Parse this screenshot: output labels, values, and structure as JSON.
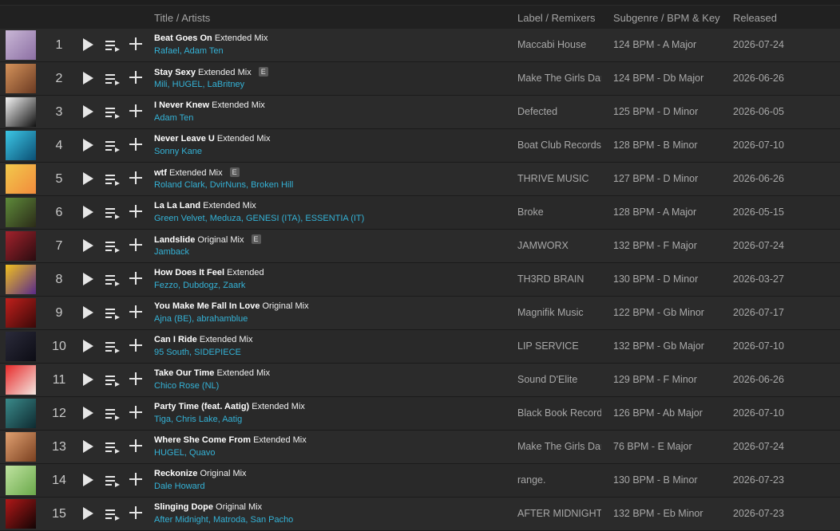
{
  "header": {
    "title_col": "Title / Artists",
    "label_col": "Label / Remixers",
    "subgenre_col": "Subgenre / BPM & Key",
    "released_col": "Released"
  },
  "tracks": [
    {
      "num": "1",
      "title": "Beat Goes On",
      "mix": "Extended Mix",
      "explicit": false,
      "artists": [
        "Rafael",
        "Adam Ten"
      ],
      "label": "Maccabi House",
      "bpm_key": "124 BPM - A Major",
      "released": "2026-07-24",
      "art": [
        "#c9b7d6",
        "#8c6fa3"
      ]
    },
    {
      "num": "2",
      "title": "Stay Sexy",
      "mix": "Extended Mix",
      "explicit": true,
      "artists": [
        "Mili",
        "HUGEL",
        "LaBritney"
      ],
      "label": "Make The Girls Dance",
      "bpm_key": "124 BPM - Db Major",
      "released": "2026-06-26",
      "art": [
        "#d4925a",
        "#6b3a22"
      ]
    },
    {
      "num": "3",
      "title": "I Never Knew",
      "mix": "Extended Mix",
      "explicit": false,
      "artists": [
        "Adam Ten"
      ],
      "label": "Defected",
      "bpm_key": "125 BPM - D Minor",
      "released": "2026-06-05",
      "art": [
        "#f4f4f4",
        "#111111"
      ]
    },
    {
      "num": "4",
      "title": "Never Leave U",
      "mix": "Extended Mix",
      "explicit": false,
      "artists": [
        "Sonny Kane"
      ],
      "label": "Boat Club Records",
      "bpm_key": "128 BPM - B Minor",
      "released": "2026-07-10",
      "art": [
        "#3cc7e6",
        "#0b4f74"
      ]
    },
    {
      "num": "5",
      "title": "wtf",
      "mix": "Extended Mix",
      "explicit": true,
      "artists": [
        "Roland Clark",
        "DvirNuns",
        "Broken Hill"
      ],
      "label": "THRIVE MUSIC",
      "bpm_key": "127 BPM - D Minor",
      "released": "2026-06-26",
      "art": [
        "#f2c94c",
        "#f28b3c"
      ]
    },
    {
      "num": "6",
      "title": "La La Land",
      "mix": "Extended Mix",
      "explicit": false,
      "artists": [
        "Green Velvet",
        "Meduza",
        "GENESI (ITA)",
        "ESSENTIA (IT)"
      ],
      "label": "Broke",
      "bpm_key": "128 BPM - A Major",
      "released": "2026-05-15",
      "art": [
        "#5e8a3a",
        "#2b2b18"
      ]
    },
    {
      "num": "7",
      "title": "Landslide",
      "mix": "Original Mix",
      "explicit": true,
      "artists": [
        "Jamback"
      ],
      "label": "JAMWORX",
      "bpm_key": "132 BPM - F Major",
      "released": "2026-07-24",
      "art": [
        "#a2222c",
        "#2a0c10"
      ]
    },
    {
      "num": "8",
      "title": "How Does It Feel",
      "mix": "Extended",
      "explicit": false,
      "artists": [
        "Fezzo",
        "Dubdogz",
        "Zaark"
      ],
      "label": "TH3RD BRAIN",
      "bpm_key": "130 BPM - D Minor",
      "released": "2026-03-27",
      "art": [
        "#f0c020",
        "#5a2a8a"
      ]
    },
    {
      "num": "9",
      "title": "You Make Me Fall In Love",
      "mix": "Original Mix",
      "explicit": false,
      "artists": [
        "Ajna (BE)",
        "abrahamblue"
      ],
      "label": "Magnifik Music",
      "bpm_key": "122 BPM - Gb Minor",
      "released": "2026-07-17",
      "art": [
        "#c0201c",
        "#3a0808"
      ]
    },
    {
      "num": "10",
      "title": "Can I Ride",
      "mix": "Extended Mix",
      "explicit": false,
      "artists": [
        "95 South",
        "SIDEPIECE"
      ],
      "label": "LIP SERVICE",
      "bpm_key": "132 BPM - Gb Major",
      "released": "2026-07-10",
      "art": [
        "#2a2a3a",
        "#0c0c14"
      ]
    },
    {
      "num": "11",
      "title": "Take Our Time",
      "mix": "Extended Mix",
      "explicit": false,
      "artists": [
        "Chico Rose (NL)"
      ],
      "label": "Sound D'Elite",
      "bpm_key": "129 BPM - F Minor",
      "released": "2026-06-26",
      "art": [
        "#e82a2a",
        "#f3e6e0"
      ]
    },
    {
      "num": "12",
      "title": "Party Time (feat. Aatig)",
      "mix": "Extended Mix",
      "explicit": false,
      "artists": [
        "Tiga",
        "Chris Lake",
        "Aatig"
      ],
      "label": "Black Book Records",
      "bpm_key": "126 BPM - Ab Major",
      "released": "2026-07-10",
      "art": [
        "#3a8a8a",
        "#0e2a30"
      ]
    },
    {
      "num": "13",
      "title": "Where She Come From",
      "mix": "Extended Mix",
      "explicit": false,
      "artists": [
        "HUGEL",
        "Quavo"
      ],
      "label": "Make The Girls Dance",
      "bpm_key": "76 BPM - E Major",
      "released": "2026-07-24",
      "art": [
        "#e0a070",
        "#7a4020"
      ]
    },
    {
      "num": "14",
      "title": "Reckonize",
      "mix": "Original Mix",
      "explicit": false,
      "artists": [
        "Dale Howard"
      ],
      "label": "range.",
      "bpm_key": "130 BPM - B Minor",
      "released": "2026-07-23",
      "art": [
        "#bfe3a0",
        "#6aa84a"
      ]
    },
    {
      "num": "15",
      "title": "Slinging Dope",
      "mix": "Original Mix",
      "explicit": false,
      "artists": [
        "After Midnight",
        "Matroda",
        "San Pacho"
      ],
      "label": "AFTER MIDNIGHT",
      "bpm_key": "132 BPM - Eb Minor",
      "released": "2026-07-23",
      "art": [
        "#b01818",
        "#120404"
      ]
    }
  ],
  "explicit_badge": "E",
  "colors": {
    "artist_link": "#34b2d6",
    "row_bg": "#2b2b2b",
    "header_text": "#a4a4a4"
  }
}
